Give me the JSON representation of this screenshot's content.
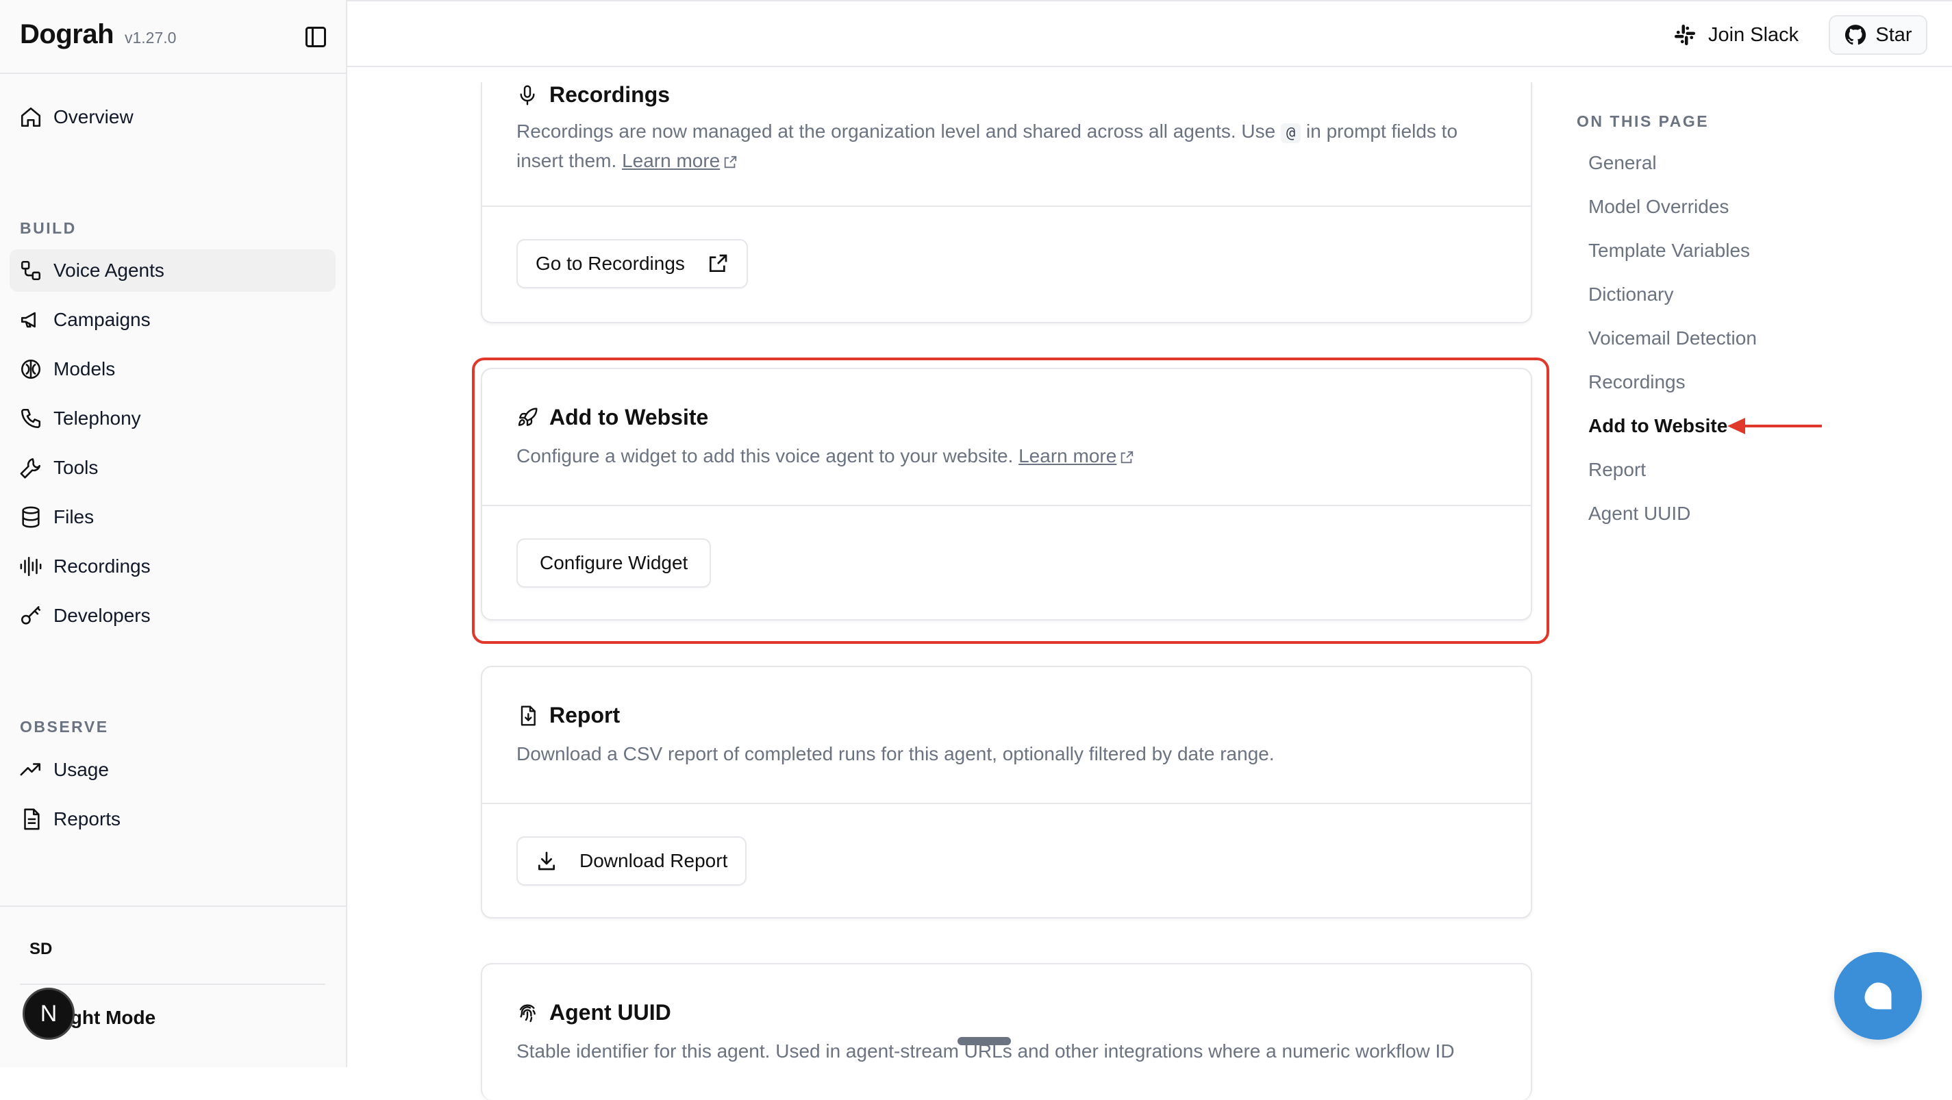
{
  "brand": {
    "name": "Dograh",
    "version": "v1.27.0"
  },
  "sidebar": {
    "overview": "Overview",
    "build_heading": "BUILD",
    "build_items": [
      {
        "label": "Voice Agents",
        "icon": "workflow-icon",
        "active": true
      },
      {
        "label": "Campaigns",
        "icon": "megaphone-icon"
      },
      {
        "label": "Models",
        "icon": "brain-icon"
      },
      {
        "label": "Telephony",
        "icon": "phone-icon"
      },
      {
        "label": "Tools",
        "icon": "wrench-icon"
      },
      {
        "label": "Files",
        "icon": "database-icon"
      },
      {
        "label": "Recordings",
        "icon": "audio-lines-icon"
      },
      {
        "label": "Developers",
        "icon": "key-icon"
      }
    ],
    "observe_heading": "OBSERVE",
    "observe_items": [
      {
        "label": "Usage",
        "icon": "trending-up-icon"
      },
      {
        "label": "Reports",
        "icon": "file-text-icon"
      }
    ],
    "user_initials": "SD",
    "mode_label": "ight Mode",
    "badge_letter": "N"
  },
  "topbar": {
    "join_slack": "Join Slack",
    "star": "Star"
  },
  "cards": {
    "recordings": {
      "title": "Recordings",
      "desc_before": "Recordings are now managed at the organization level and shared across all agents. Use",
      "code": "@",
      "desc_after": "in prompt fields to insert them.",
      "learn_more": "Learn more",
      "button": "Go to Recordings"
    },
    "website": {
      "title": "Add to Website",
      "desc": "Configure a widget to add this voice agent to your website.",
      "learn_more": "Learn more",
      "button": "Configure Widget"
    },
    "report": {
      "title": "Report",
      "desc": "Download a CSV report of completed runs for this agent, optionally filtered by date range.",
      "button": "Download Report"
    },
    "uuid": {
      "title": "Agent UUID",
      "desc": "Stable identifier for this agent. Used in agent-stream URLs and other integrations where a numeric workflow ID"
    }
  },
  "toc": {
    "title": "ON THIS PAGE",
    "items": [
      "General",
      "Model Overrides",
      "Template Variables",
      "Dictionary",
      "Voicemail Detection",
      "Recordings",
      "Add to Website",
      "Report",
      "Agent UUID"
    ],
    "active": "Add to Website"
  },
  "colors": {
    "highlight": "#e0392b",
    "chat": "#3b8fd9"
  }
}
